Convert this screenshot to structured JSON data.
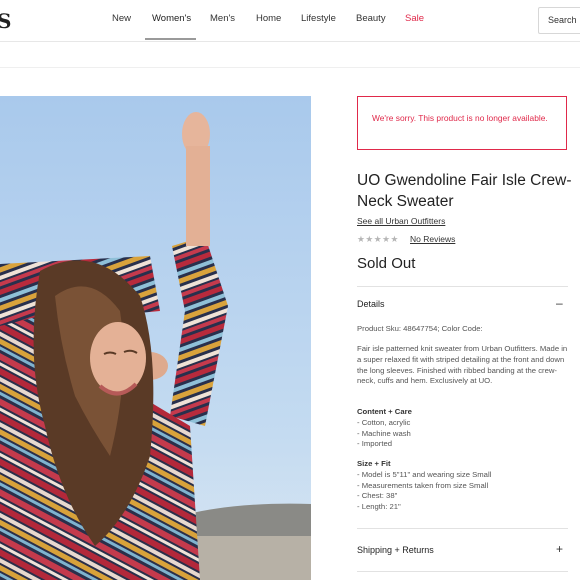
{
  "header": {
    "logo_fragment": "S",
    "nav": [
      "New",
      "Women's",
      "Men's",
      "Home",
      "Lifestyle",
      "Beauty",
      "Sale"
    ],
    "search_label": "Search"
  },
  "alert": {
    "message": "We're sorry. This product is no longer available."
  },
  "product": {
    "title": "UO Gwendoline Fair Isle Crew-Neck Sweater",
    "brand_link": "See all Urban Outfitters",
    "rating_stars": "★★★★★",
    "reviews_link": "No Reviews",
    "status": "Sold Out"
  },
  "details": {
    "heading": "Details",
    "sku_line": "Product Sku: 48647754; Color Code:",
    "description": "Fair isle patterned knit sweater from Urban Outfitters. Made in a super relaxed fit with striped detailing at the front and down the long sleeves. Finished with ribbed banding at the crew-neck, cuffs and hem. Exclusively at UO.",
    "content_care_heading": "Content + Care",
    "content_care_items": [
      "- Cotton, acrylic",
      "- Machine wash",
      "- Imported"
    ],
    "size_fit_heading": "Size + Fit",
    "size_fit_items": [
      "- Model is 5\"11\" and wearing size Small",
      "- Measurements taken from size Small",
      "- Chest: 38\"",
      "- Length: 21\""
    ]
  },
  "shipping": {
    "heading": "Shipping + Returns"
  },
  "icons": {
    "collapse": "minus-icon",
    "expand": "plus-icon"
  },
  "colors": {
    "sale": "#e0294a",
    "alert_border": "#e0294a"
  }
}
